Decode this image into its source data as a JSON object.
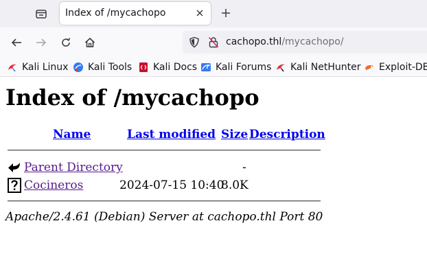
{
  "browser": {
    "tab": {
      "title": "Index of /mycachopo"
    },
    "url": {
      "host": "cachopo.thl",
      "path": "/mycachopo/"
    },
    "bookmarks": [
      {
        "label": "Kali Linux",
        "icon": "kali-dragon-icon"
      },
      {
        "label": "Kali Tools",
        "icon": "kali-tools-icon"
      },
      {
        "label": "Kali Docs",
        "icon": "kali-docs-icon"
      },
      {
        "label": "Kali Forums",
        "icon": "kali-forums-icon"
      },
      {
        "label": "Kali NetHunter",
        "icon": "kali-nethunter-icon"
      },
      {
        "label": "Exploit-DB",
        "icon": "exploit-db-icon"
      }
    ],
    "colors": {
      "tabbar": "#f0f0f4",
      "toolbar": "#f9f9fb",
      "urlbar": "#f0f0f4"
    }
  },
  "page": {
    "title": "Index of /mycachopo",
    "columns": {
      "name": "Name",
      "modified": "Last modified",
      "size": "Size",
      "description": "Description"
    },
    "rows": [
      {
        "icon": "back-arrow-icon",
        "name": "Parent Directory",
        "modified": "",
        "size": "-",
        "description": ""
      },
      {
        "icon": "unknown-file-icon",
        "name": "Cocineros",
        "modified": "2024-07-15 10:40",
        "size": "8.0K",
        "description": ""
      }
    ],
    "address": "Apache/2.4.61 (Debian) Server at cachopo.thl Port 80",
    "colors": {
      "link": "#0000ee",
      "visited": "#551a8b"
    }
  }
}
